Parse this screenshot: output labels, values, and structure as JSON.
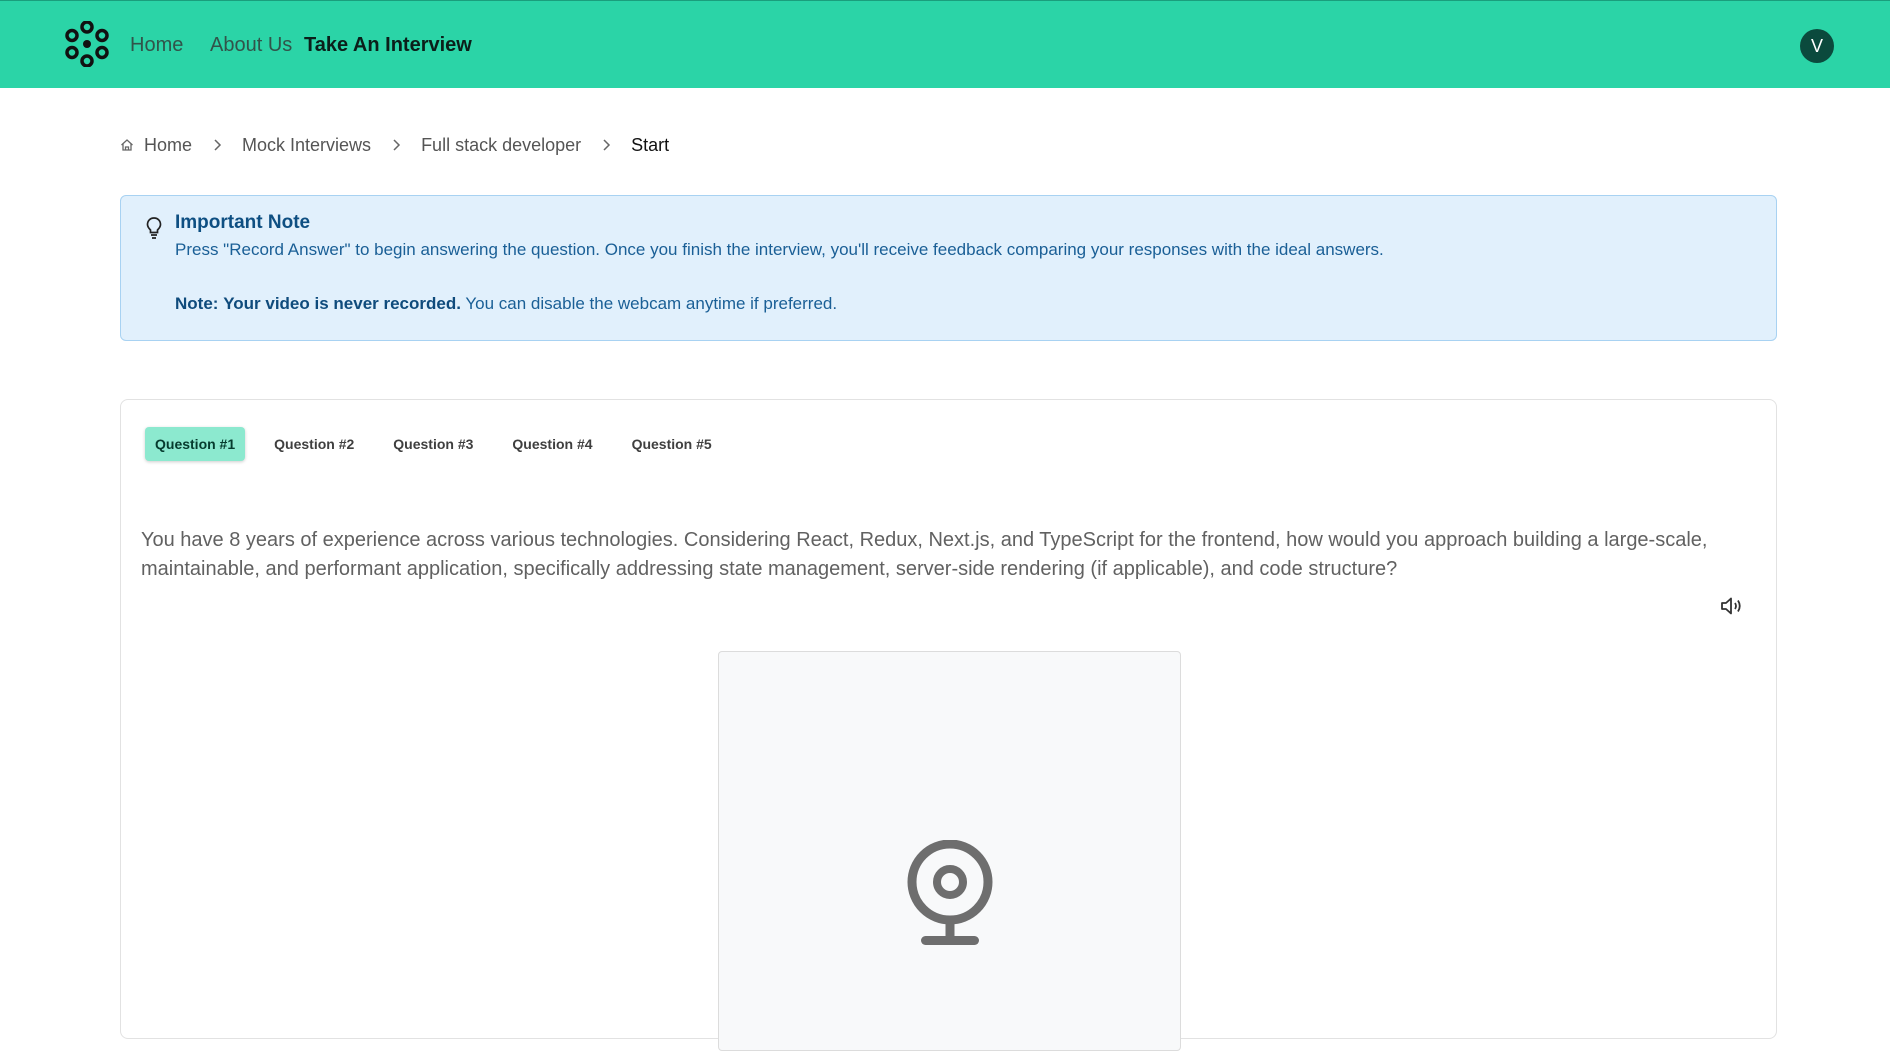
{
  "header": {
    "logo_icon": "flower-dots-logo",
    "nav": [
      {
        "label": "Home"
      },
      {
        "label": "About Us"
      },
      {
        "label": "Take An Interview"
      }
    ],
    "avatar_initial": "V"
  },
  "breadcrumb": {
    "items": [
      {
        "label": "Home",
        "icon": "home-icon"
      },
      {
        "label": "Mock Interviews"
      },
      {
        "label": "Full stack developer"
      },
      {
        "label": "Start"
      }
    ]
  },
  "note": {
    "icon": "lightbulb-icon",
    "title": "Important Note",
    "text": "Press \"Record Answer\" to begin answering the question. Once you finish the interview, you'll receive feedback comparing your responses with the ideal answers.",
    "note_label": "Note:",
    "note_bold": "Your video is never recorded.",
    "note_rest": " You can disable the webcam anytime if preferred."
  },
  "interview": {
    "tabs": [
      {
        "label": "Question #1"
      },
      {
        "label": "Question #2"
      },
      {
        "label": "Question #3"
      },
      {
        "label": "Question #4"
      },
      {
        "label": "Question #5"
      }
    ],
    "active_tab": 0,
    "question": "You have 8 years of experience across various technologies. Considering React, Redux, Next.js, and TypeScript for the frontend, how would you approach building a large-scale, maintainable, and performant application, specifically addressing state management, server-side rendering (if applicable), and code structure?",
    "speaker_icon": "speaker-icon",
    "webcam_icon": "webcam-icon"
  },
  "colors": {
    "header_bg": "#2bd4a7",
    "active_tab_bg": "#8ce9cf",
    "note_bg": "#e1f0fc",
    "avatar_bg": "#0b4a3d"
  }
}
